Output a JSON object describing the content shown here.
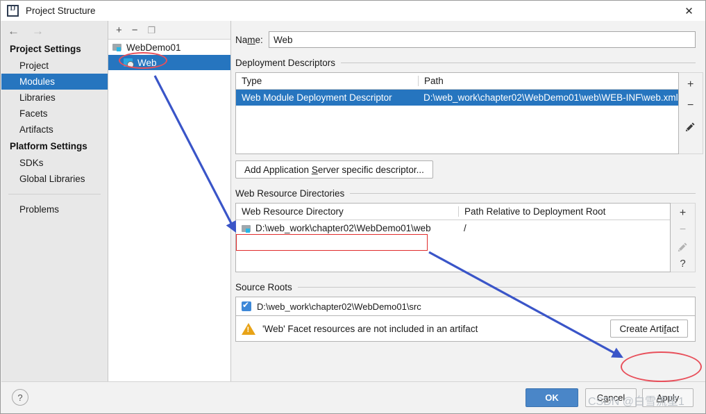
{
  "window": {
    "title": "Project Structure",
    "app_icon": "intellij-idea-icon",
    "close_label": "✕"
  },
  "nav": {
    "back_icon": "arrow-left-icon",
    "forward_icon": "arrow-right-icon"
  },
  "sidebar": {
    "groups": [
      {
        "title": "Project Settings",
        "items": [
          {
            "label": "Project",
            "selected": false
          },
          {
            "label": "Modules",
            "selected": true
          },
          {
            "label": "Libraries",
            "selected": false
          },
          {
            "label": "Facets",
            "selected": false
          },
          {
            "label": "Artifacts",
            "selected": false
          }
        ]
      },
      {
        "title": "Platform Settings",
        "items": [
          {
            "label": "SDKs",
            "selected": false
          },
          {
            "label": "Global Libraries",
            "selected": false
          }
        ]
      }
    ],
    "problems_label": "Problems"
  },
  "tree": {
    "toolbar": {
      "add_label": "+",
      "remove_label": "−",
      "copy_label": "❐"
    },
    "nodes": [
      {
        "label": "WebDemo01",
        "icon": "module-folder-icon",
        "selected": false,
        "child": false
      },
      {
        "label": "Web",
        "icon": "web-facet-icon",
        "selected": true,
        "child": true
      }
    ]
  },
  "main": {
    "name_field": {
      "label_pre": "Na",
      "label_mnemonic": "m",
      "label_post": "e:",
      "value": "Web"
    },
    "deployment_descriptors": {
      "section_title": "Deployment Descriptors",
      "columns": [
        "Type",
        "Path"
      ],
      "rows": [
        {
          "type": "Web Module Deployment Descriptor",
          "path": "D:\\web_work\\chapter02\\WebDemo01\\web\\WEB-INF\\web.xml",
          "selected": true
        }
      ],
      "toolbar": [
        {
          "icon": "plus-icon",
          "label": "+",
          "enabled": true
        },
        {
          "icon": "minus-icon",
          "label": "−",
          "enabled": true
        },
        {
          "icon": "pencil-icon",
          "label": "✎",
          "enabled": true
        }
      ]
    },
    "add_server_descriptor_button": {
      "pre": "Add Application ",
      "mnemonic": "S",
      "post": "erver specific descriptor..."
    },
    "web_resource_directories": {
      "section_title": "Web Resource Directories",
      "columns": [
        "Web Resource Directory",
        "Path Relative to Deployment Root"
      ],
      "rows": [
        {
          "directory": "D:\\web_work\\chapter02\\WebDemo01\\web",
          "relative_path": "/",
          "icon": "directory-icon"
        }
      ],
      "toolbar": [
        {
          "icon": "plus-icon",
          "label": "+",
          "enabled": true
        },
        {
          "icon": "minus-icon",
          "label": "−",
          "enabled": false
        },
        {
          "icon": "pencil-icon",
          "label": "✎",
          "enabled": false
        },
        {
          "icon": "question-icon",
          "label": "?",
          "enabled": true
        }
      ]
    },
    "source_roots": {
      "section_title": "Source Roots",
      "rows": [
        {
          "path": "D:\\web_work\\chapter02\\WebDemo01\\src",
          "checked": true
        }
      ]
    },
    "warning": {
      "icon": "warning-triangle-icon",
      "text": "'Web' Facet resources are not included in an artifact",
      "action": {
        "pre": "Create Arti",
        "mnemonic": "f",
        "post": "act"
      }
    }
  },
  "footer": {
    "help_label": "?",
    "ok_label": "OK",
    "cancel": {
      "pre": "C",
      "mnemonic": "a",
      "post": "ncel"
    },
    "apply": {
      "pre": "",
      "mnemonic": "A",
      "post": "pply"
    }
  },
  "annotations": {
    "watermark": "CSDN @白雪流星1",
    "highlight_color": "#e8505b",
    "box_color": "#e02b2b",
    "arrow_color": "#3a55c8"
  }
}
